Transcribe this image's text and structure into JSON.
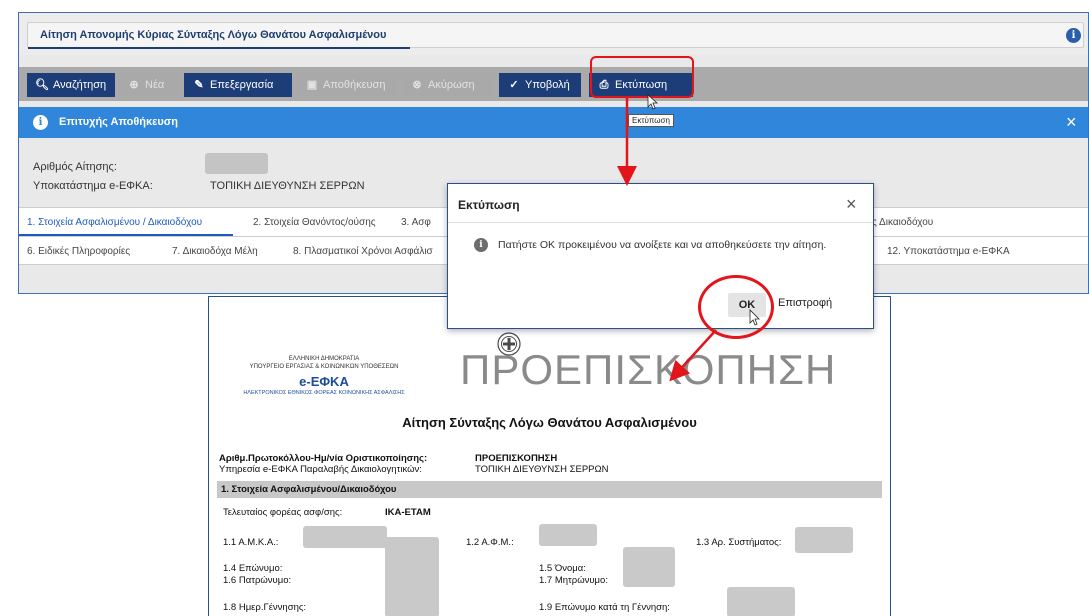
{
  "window": {
    "title": "Αίτηση Απονομής Κύριας Σύνταξης Λόγω Θανάτου Ασφαλισμένου"
  },
  "toolbar": {
    "search": "Αναζήτηση",
    "new": "Νέα",
    "edit": "Επεξεργασία",
    "save": "Αποθήκευση",
    "cancel": "Ακύρωση",
    "submit": "Υποβολή",
    "print": "Εκτύπωση"
  },
  "tooltip": "Εκτύπωση",
  "alert": {
    "message": "Επιτυχής Αποθήκευση",
    "close": "×"
  },
  "form": {
    "application_number_label": "Αριθμός Αίτησης:",
    "branch_label": "Υποκατάστημα e-ΕΦΚΑ:",
    "branch_value": "ΤΟΠΙΚΗ ΔΙΕΥΘΥΝΣΗ ΣΕΡΡΩΝ"
  },
  "tabs_row1": [
    "1. Στοιχεία Ασφαλισμένου / Δικαιοδόχου",
    "2. Στοιχεία Θανόντος/ούσης",
    "3. Ασφ",
    "ς Δικαιοδόχου"
  ],
  "tabs_row2": [
    "6. Ειδικές Πληροφορίες",
    "7. Δικαιοδόχα Μέλη",
    "8. Πλασματικοί Χρόνοι Ασφάλισ",
    "12. Υποκατάστημα e-ΕΦΚΑ"
  ],
  "modal": {
    "title": "Εκτύπωση",
    "close": "×",
    "message": "Πατήστε ΟΚ προκειμένου να ανοίξετε και να αποθηκεύσετε την αίτηση.",
    "ok": "ΟΚ",
    "back": "Επιστροφή"
  },
  "document": {
    "org_line1": "ΕΛΛΗΝΙΚΗ ΔΗΜΟΚΡΑΤΙΑ",
    "org_line2": "ΥΠΟΥΡΓΕΙΟ ΕΡΓΑΣΙΑΣ & ΚΟΙΝΩΝΙΚΩΝ ΥΠΟΘΕΣΕΩΝ",
    "org_logo": "e-ΕΦΚΑ",
    "org_line3": "ΗΛΕΚΤΡΟΝΙΚΟΣ ΕΘΝΙΚΟΣ ΦΟΡΕΑΣ ΚΟΙΝΩΝΙΚΗΣ ΑΣΦΑΛΙΣΗΣ",
    "watermark": "ΠΡΟΕΠΙΣΚΟΠΗΣΗ",
    "title": "Αίτηση Σύνταξης Λόγω Θανάτου Ασφαλισμένου",
    "protocol_label": "Αριθμ.Πρωτοκόλλου-Ημ/νία Οριστικοποίησης:",
    "protocol_value": "ΠΡΟΕΠΙΣΚΟΠΗΣΗ",
    "service_label": "Υπηρεσία e-ΕΦΚΑ Παραλαβής Δικαιολογητικών:",
    "service_value": "ΤΟΠΙΚΗ ΔΙΕΥΘΥΝΣΗ ΣΕΡΡΩΝ",
    "section1": "1. Στοιχεία Ασφαλισμένου/Δικαιοδόχου",
    "last_fund_label": "Τελευταίος φορέας ασφ/σης:",
    "last_fund_value": "ΙΚΑ-ΕΤΑΜ",
    "f_11": "1.1 Α.Μ.Κ.Α.:",
    "f_12": "1.2 Α.Φ.Μ.:",
    "f_13": "1.3 Αρ. Συστήματος:",
    "f_14": "1.4 Επώνυμο:",
    "f_15": "1.5 Όνομα:",
    "f_16": "1.6 Πατρώνυμο:",
    "f_17": "1.7 Μητρώνυμο:",
    "f_18": "1.8 Ημερ.Γέννησης:",
    "f_19": "1.9 Επώνυμο κατά τη Γέννηση:"
  }
}
